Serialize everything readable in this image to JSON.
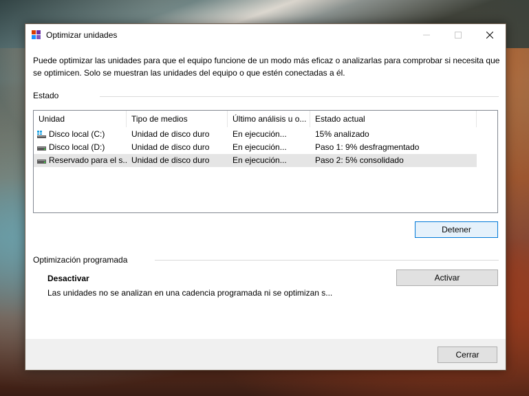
{
  "window": {
    "title": "Optimizar unidades",
    "description": "Puede optimizar las unidades para que el equipo funcione de un modo más eficaz o analizarlas para comprobar si necesita que se optimicen. Solo se muestran las unidades del equipo o que estén conectadas a él."
  },
  "status": {
    "label": "Estado",
    "columns": [
      "Unidad",
      "Tipo de medios",
      "Último análisis u o...",
      "Estado actual"
    ],
    "rows": [
      {
        "unit": "Disco local (C:)",
        "media": "Unidad de disco duro",
        "last": "En ejecución...",
        "state": "15% analizado",
        "icon": "system-drive-icon"
      },
      {
        "unit": "Disco local (D:)",
        "media": "Unidad de disco duro",
        "last": "En ejecución...",
        "state": "Paso 1: 9% desfragmentado",
        "icon": "hard-drive-icon"
      },
      {
        "unit": "Reservado para el s...",
        "media": "Unidad de disco duro",
        "last": "En ejecución...",
        "state": "Paso 2: 5% consolidado",
        "icon": "hard-drive-icon",
        "selected": true
      }
    ],
    "stop_button": "Detener"
  },
  "schedule": {
    "label": "Optimización programada",
    "state_title": "Desactivar",
    "state_text": "Las unidades no se analizan en una cadencia programada ni se optimizan s...",
    "activate_button": "Activar"
  },
  "footer": {
    "close_button": "Cerrar"
  },
  "colors": {
    "accent": "#0078d7",
    "selected_row": "#e5e5e5",
    "footer_bg": "#f0f0f0"
  }
}
